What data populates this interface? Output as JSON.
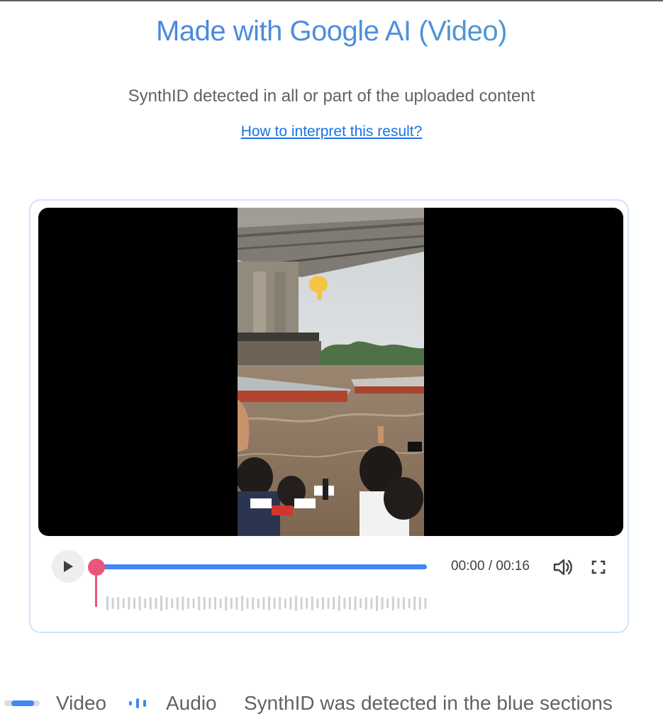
{
  "header": {
    "title": "Made with Google AI (Video)",
    "subtitle": "SynthID detected in all or part of the uploaded content",
    "interpret_link": "How to interpret this result?"
  },
  "player": {
    "current_time": "00:00",
    "duration": "00:16",
    "time_display": "00:00 / 00:16",
    "playback_progress": 0.0,
    "detected_fraction": 1.0,
    "play_icon": "play-icon",
    "volume_icon": "volume-icon",
    "fullscreen_icon": "fullscreen-icon",
    "video_overlay_text": [
      "सांस्कृतिक",
      "चैनल",
      "ZEE"
    ]
  },
  "legend": {
    "video_label": "Video",
    "audio_label": "Audio",
    "note": "SynthID was detected in the blue sections"
  },
  "colors": {
    "title_gradient_start": "#4a7fe0",
    "title_gradient_end": "#4aa3c8",
    "link": "#1a73e8",
    "detected_blue": "#4285f4",
    "playhead": "#e8577a",
    "card_border": "#d2e3fc",
    "waveform": "#cfd1d4",
    "text_gray": "#5f6368"
  }
}
